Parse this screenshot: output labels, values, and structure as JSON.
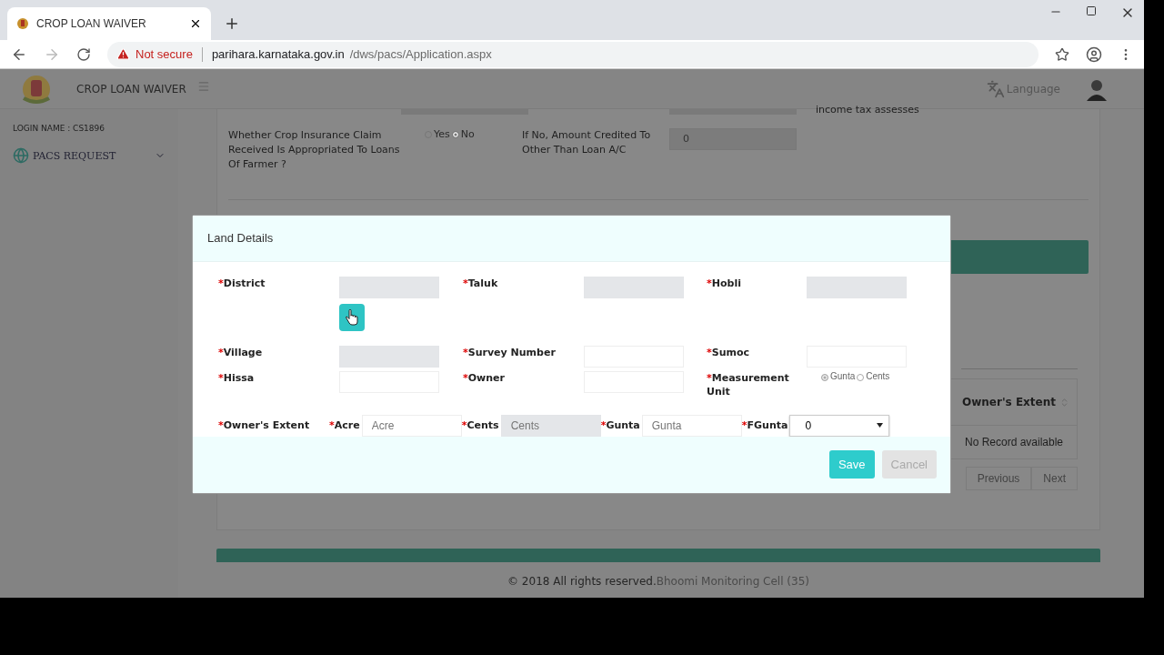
{
  "browser": {
    "tab_title": "CROP LOAN WAIVER",
    "security": "Not secure",
    "url_host": "parihara.karnataka.gov.in",
    "url_path": "/dws/pacs/Application.aspx"
  },
  "header": {
    "title": "CROP LOAN WAIVER",
    "language": "Language"
  },
  "sidebar": {
    "login": "LOGIN NAME : CS1896",
    "items": [
      {
        "label": "PACS REQUEST",
        "expanded": false
      }
    ]
  },
  "form": {
    "note": "income tax assesses",
    "question": "Whether Crop Insurance Claim Received Is Appropriated To Loans Of Farmer ?",
    "options": [
      {
        "label": "Yes",
        "selected": false
      },
      {
        "label": "No",
        "selected": true
      }
    ],
    "amount_label": "If No, Amount Credited To Other Than Loan A/C",
    "amount_value": "0"
  },
  "table": {
    "column": "Owner's Extent",
    "empty": "No Record available",
    "pager": [
      "Previous",
      "Next"
    ]
  },
  "footer": {
    "text": "© 2018 All rights reserved.",
    "link": "Bhoomi Monitoring Cell (35)"
  },
  "modal": {
    "title": "Land Details",
    "fields": [
      {
        "mark": "*",
        "label": "District",
        "kind": "input",
        "disabled": true
      },
      {
        "mark": "*",
        "label": "Taluk",
        "kind": "input",
        "disabled": true
      },
      {
        "mark": "*",
        "label": "Hobli",
        "kind": "input",
        "disabled": true
      },
      {
        "mark": "*",
        "label": "Village",
        "kind": "input",
        "disabled": true
      },
      {
        "mark": "*",
        "label": "Survey Number",
        "kind": "input",
        "disabled": false
      },
      {
        "mark": "*",
        "label": "Sumoc",
        "kind": "input",
        "disabled": false
      },
      {
        "mark": "*",
        "label": "Hissa",
        "kind": "input",
        "disabled": false
      },
      {
        "mark": "*",
        "label": "Owner",
        "kind": "input",
        "disabled": false
      },
      {
        "mark": "*",
        "label": "Measurement Unit",
        "kind": "radio",
        "options": [
          {
            "label": "Gunta",
            "selected": true
          },
          {
            "label": "Cents",
            "selected": false
          }
        ]
      }
    ],
    "extent": {
      "mark": "*",
      "label": "Owner's Extent",
      "parts": [
        {
          "mark": "*",
          "label": "Acre",
          "kind": "input",
          "placeholder": "Acre",
          "disabled": false
        },
        {
          "mark": "*",
          "label": "Cents",
          "kind": "input",
          "placeholder": "Cents",
          "disabled": true
        },
        {
          "mark": "*",
          "label": "Gunta",
          "kind": "input",
          "placeholder": "Gunta",
          "disabled": false
        },
        {
          "mark": "*",
          "label": "FGunta",
          "kind": "select",
          "value": "0"
        }
      ]
    },
    "buttons": [
      {
        "label": "Save",
        "kind": "primary"
      },
      {
        "label": "Cancel",
        "kind": "secondary"
      }
    ]
  }
}
